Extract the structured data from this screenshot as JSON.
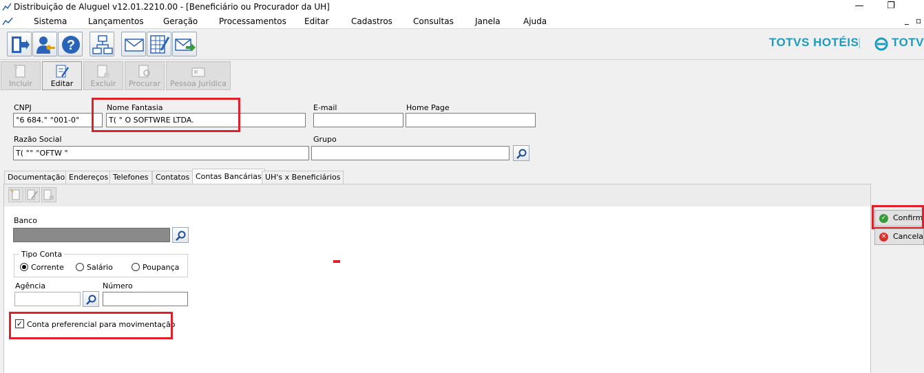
{
  "window": {
    "title": "Distribuição de Aluguel v12.01.2210.00 - [Beneficiário ou Procurador da UH]",
    "minimize_glyph": "—",
    "restore_glyph": "❐",
    "inner_min_glyph": "_",
    "inner_restore_glyph": "▫"
  },
  "menu": [
    "Sistema",
    "Lançamentos",
    "Geração",
    "Processamentos",
    "Editar",
    "Cadastros",
    "Consultas",
    "Janela",
    "Ajuda"
  ],
  "toolbar_icons": [
    "exit-door-icon",
    "user-key-icon",
    "help-icon",
    "org-chart-icon",
    "mail-icon",
    "spreadsheet-edit-icon",
    "mail-send-icon"
  ],
  "brand": {
    "left": "TOTVS HOTÉIS",
    "separator": "|",
    "right": "TOTVS",
    "color": "#1a9bbf"
  },
  "actions": [
    "Incluir",
    "Editar",
    "Excluir",
    "Procurar",
    "Pessoa Jurídica"
  ],
  "form": {
    "cnpj_label": "CNPJ",
    "cnpj_value": "°6 684.° °001-0°",
    "nome_fantasia_label": "Nome Fantasia",
    "nome_fantasia_value": "T( ° O SOFTWRE LTDA.",
    "email_label": "E-mail",
    "email_value": "",
    "home_page_label": "Home Page",
    "home_page_value": "",
    "razao_social_label": "Razão Social",
    "razao_social_value": "T(  °° °OFTW ° ",
    "grupo_label": "Grupo",
    "grupo_value": ""
  },
  "tabs": [
    "Documentação",
    "Endereços",
    "Telefones",
    "Contatos",
    "Contas Bancárias",
    "UH's x Beneficiários"
  ],
  "selected_tab": "Contas Bancárias",
  "bank_form": {
    "banco_label": "Banco",
    "banco_value": "",
    "tipo_conta_label": "Tipo Conta",
    "tipo_options": [
      "Corrente",
      "Salário",
      "Poupança"
    ],
    "tipo_selected": "Corrente",
    "agencia_label": "Agência",
    "agencia_value": "",
    "numero_label": "Número",
    "numero_value": "",
    "preferencial_label": "Conta preferencial para movimentação",
    "preferencial_checked": "✓"
  },
  "side_buttons": {
    "confirmar": "Confirmar",
    "cancelar": "Cancelar"
  },
  "colors": {
    "highlight": "#e0202a",
    "confirm": "#3a9a3a",
    "cancel": "#d9342b"
  }
}
